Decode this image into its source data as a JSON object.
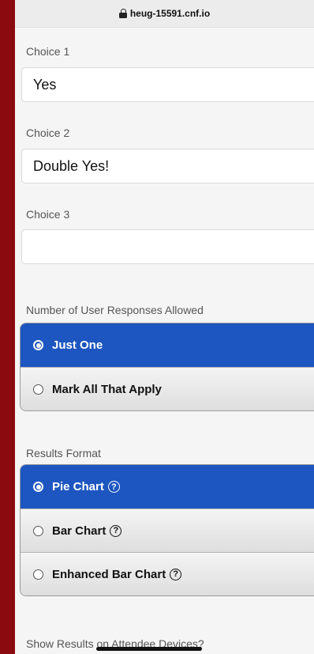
{
  "browser": {
    "url": "heug-15591.cnf.io"
  },
  "choices": [
    {
      "label": "Choice 1",
      "value": "Yes"
    },
    {
      "label": "Choice 2",
      "value": "Double Yes!"
    },
    {
      "label": "Choice 3",
      "value": ""
    }
  ],
  "responses": {
    "label": "Number of User Responses Allowed",
    "options": [
      {
        "label": "Just One",
        "selected": true
      },
      {
        "label": "Mark All That Apply",
        "selected": false
      }
    ]
  },
  "results": {
    "label": "Results Format",
    "options": [
      {
        "label": "Pie Chart",
        "selected": true,
        "help": "?"
      },
      {
        "label": "Bar Chart",
        "selected": false,
        "help": "?"
      },
      {
        "label": "Enhanced Bar Chart",
        "selected": false,
        "help": "?"
      }
    ]
  },
  "show_results": {
    "label": "Show Results on Attendee Devices?"
  },
  "colors": {
    "side": "#8b0a0f",
    "selected": "#1d56c0"
  },
  "icons": {
    "lock": "lock-icon",
    "help": "help-circle-icon"
  }
}
